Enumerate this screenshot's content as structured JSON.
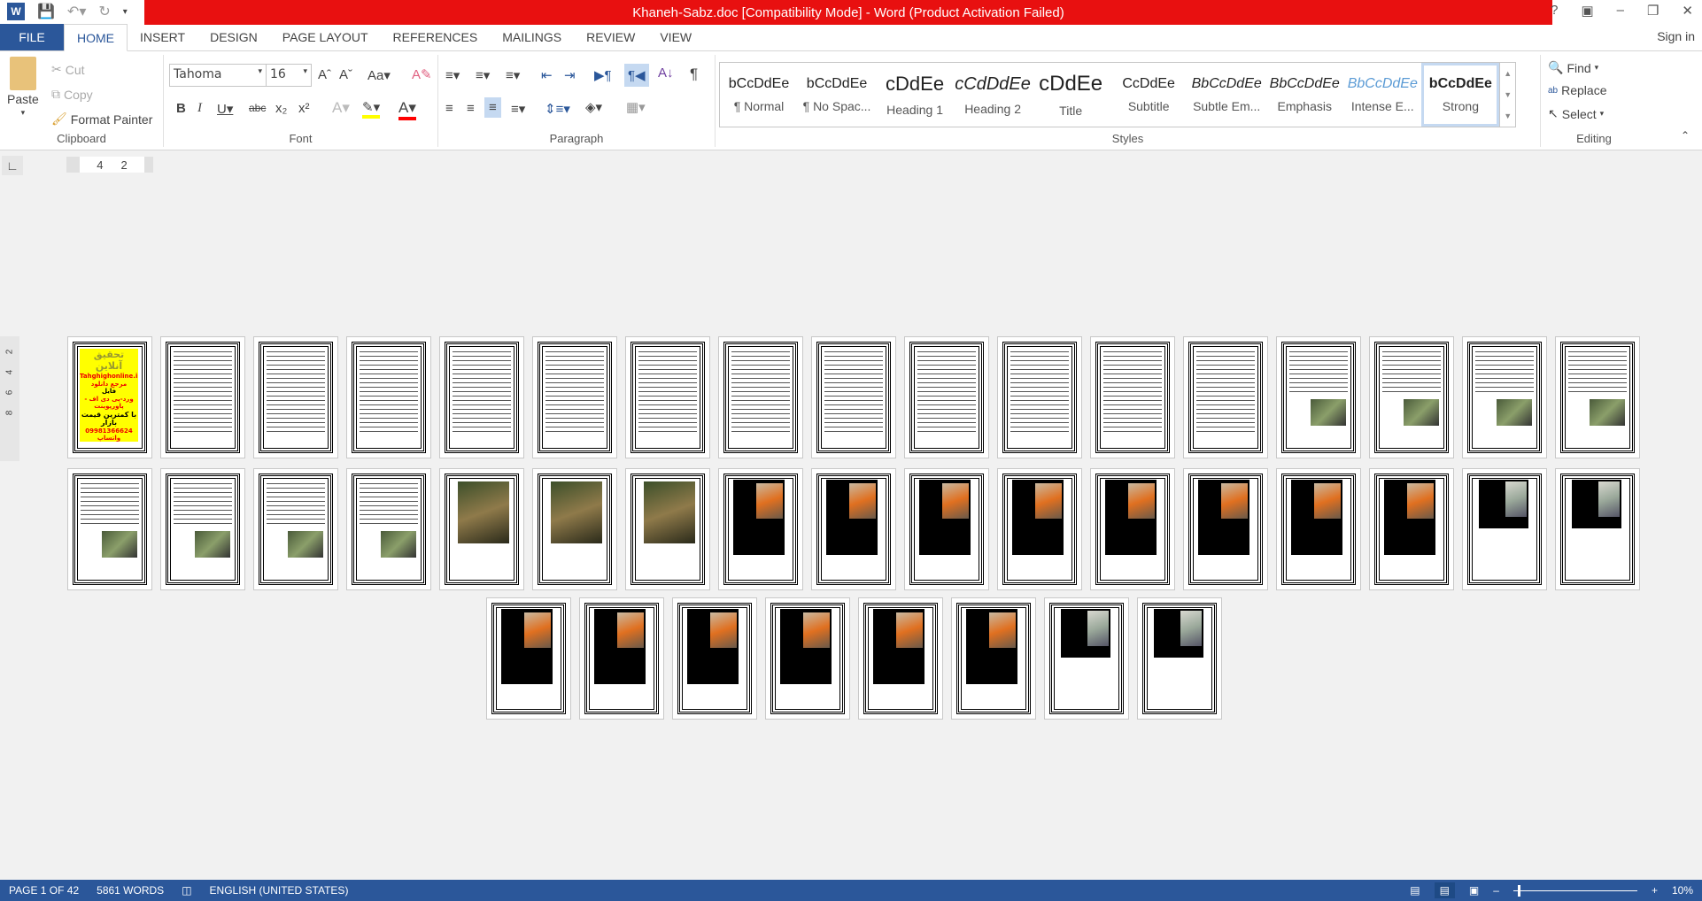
{
  "window": {
    "title": "Khaneh-Sabz.doc [Compatibility Mode] -  Word (Product Activation Failed)",
    "sign_in": "Sign in",
    "app_icon": "W"
  },
  "tabs": [
    "FILE",
    "HOME",
    "INSERT",
    "DESIGN",
    "PAGE LAYOUT",
    "REFERENCES",
    "MAILINGS",
    "REVIEW",
    "VIEW"
  ],
  "active_tab": "HOME",
  "clipboard": {
    "paste": "Paste",
    "cut": "Cut",
    "copy": "Copy",
    "format_painter": "Format Painter",
    "label": "Clipboard"
  },
  "font": {
    "name": "Tahoma",
    "size": "16",
    "label": "Font",
    "case_label": "Aa",
    "highlight_color": "#ffff00",
    "font_color": "#ff0000"
  },
  "paragraph": {
    "label": "Paragraph"
  },
  "styles": {
    "label": "Styles",
    "items": [
      {
        "preview": "bCcDdEe",
        "name": "¶ Normal"
      },
      {
        "preview": "bCcDdEe",
        "name": "¶ No Spac..."
      },
      {
        "preview": "cDdEe",
        "name": "Heading 1"
      },
      {
        "preview": "cCdDdEe",
        "name": "Heading 2"
      },
      {
        "preview": "cDdEe",
        "name": "Title"
      },
      {
        "preview": "CcDdEe",
        "name": "Subtitle"
      },
      {
        "preview": "BbCcDdEe",
        "name": "Subtle Em..."
      },
      {
        "preview": "BbCcDdEe",
        "name": "Emphasis"
      },
      {
        "preview": "BbCcDdEe",
        "name": "Intense E..."
      },
      {
        "preview": "bCcDdEe",
        "name": "Strong"
      }
    ],
    "selected": "Strong"
  },
  "editing": {
    "find": "Find",
    "replace": "Replace",
    "select": "Select",
    "label": "Editing"
  },
  "ruler": {
    "marks": [
      "4",
      "2"
    ],
    "vertical_marks": [
      "2",
      "4",
      "6",
      "8"
    ]
  },
  "first_page_ad": [
    "تحقیق آنلاین",
    "Tahghighonline.ir",
    "مرجع دانلود",
    "فایل",
    "ورد-پی دی اف - پاورپوینت",
    "با کمترین قیمت بازار",
    "09981366624 واتساپ"
  ],
  "pages": {
    "rows": [
      [
        "ad",
        "text",
        "text",
        "text",
        "text",
        "text",
        "text",
        "text",
        "text",
        "text",
        "text",
        "text",
        "text",
        "textimg",
        "textimg",
        "textimg",
        "textimg"
      ],
      [
        "textimg",
        "textimg",
        "textimg",
        "textimg",
        "image",
        "image",
        "image",
        "dark",
        "dark",
        "dark",
        "dark",
        "dark",
        "dark",
        "dark",
        "dark",
        "darkshort",
        "darkshort"
      ],
      [
        "dark",
        "dark",
        "dark",
        "dark",
        "dark",
        "dark",
        "darkshort",
        "darkshort"
      ]
    ]
  },
  "status": {
    "page": "PAGE 1 OF 42",
    "words": "5861 WORDS",
    "language": "ENGLISH (UNITED STATES)",
    "zoom": "10%",
    "zoom_percent": 10
  }
}
